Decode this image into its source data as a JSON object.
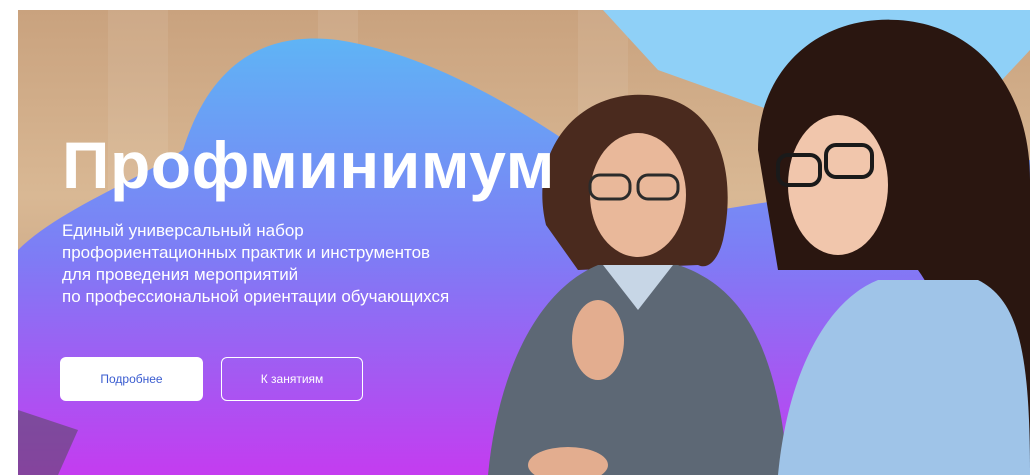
{
  "hero": {
    "title": "Профминимум",
    "subtitle_lines": [
      "Единый универсальный набор",
      "профориентационных практик и инструментов",
      "для проведения мероприятий",
      "по профессиональной ориентации обучающихся"
    ],
    "buttons": {
      "details_label": "Подробнее",
      "lessons_label": "К занятиям"
    }
  },
  "colors": {
    "gradient_top": "#5fb4f5",
    "gradient_mid": "#7e7cf5",
    "gradient_bottom": "#c43cf0",
    "light_blue_shape": "#8fd0f7",
    "button_text": "#3a5cd0"
  }
}
